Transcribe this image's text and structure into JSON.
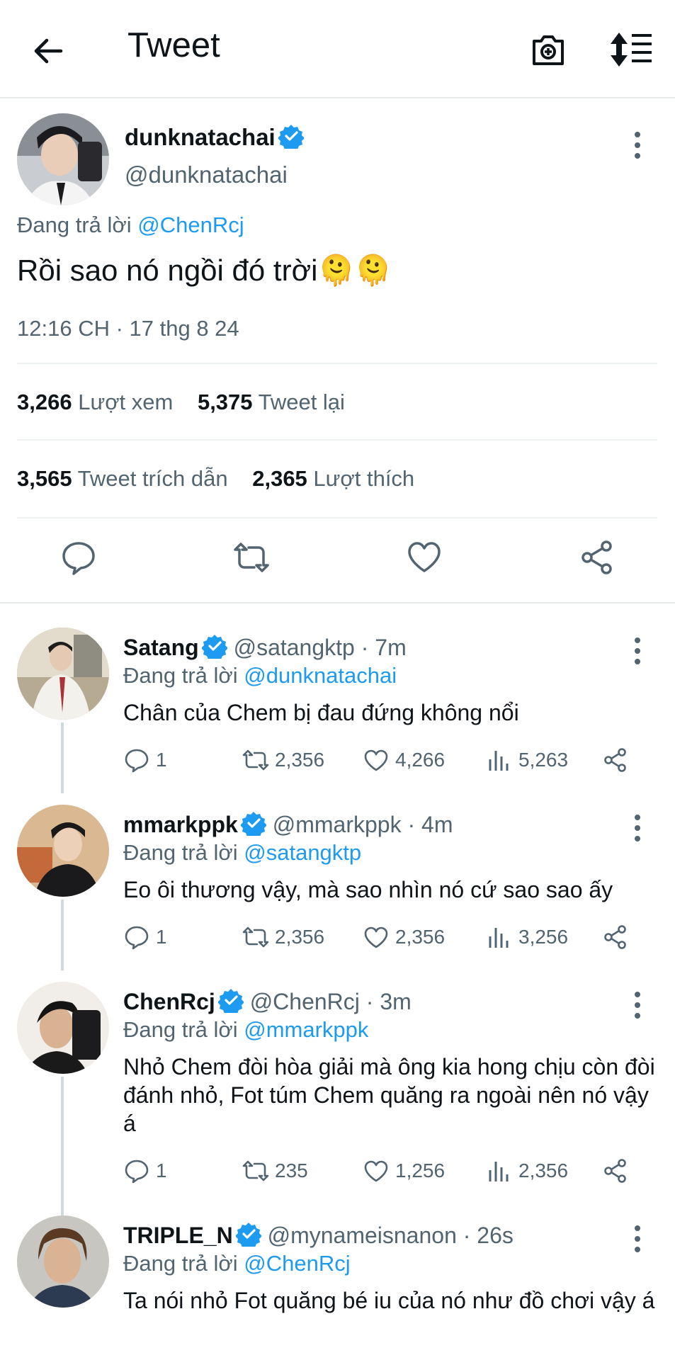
{
  "header": {
    "title": "Tweet"
  },
  "tweet": {
    "display_name": "dunknatachai",
    "handle": "@dunknatachai",
    "reply_prefix": "Đang trả lời",
    "reply_to": "@ChenRcj",
    "text": "Rồi sao nó ngồi đó trời🫠🫠",
    "timestamp": "12:16 CH · 17 thg 8 24",
    "stats": {
      "views_count": "3,266",
      "views_label": "Lượt xem",
      "retweets_count": "5,375",
      "retweets_label": "Tweet lại",
      "quotes_count": "3,565",
      "quotes_label": "Tweet trích dẫn",
      "likes_count": "2,365",
      "likes_label": "Lượt thích"
    }
  },
  "replies": [
    {
      "display_name": "Satang",
      "handle": "@satangktp",
      "time": "7m",
      "reply_prefix": "Đang trả lời",
      "reply_to": "@dunknatachai",
      "text": "Chân của Chem bị đau đứng không nổi",
      "comments": "1",
      "retweets": "2,356",
      "likes": "4,266",
      "views": "5,263"
    },
    {
      "display_name": "mmarkppk",
      "handle": "@mmarkppk",
      "time": "4m",
      "reply_prefix": "Đang trả lời",
      "reply_to": "@satangktp",
      "text": "Eo ôi thương vậy, mà sao nhìn nó cứ sao sao ấy",
      "comments": "1",
      "retweets": "2,356",
      "likes": "2,356",
      "views": "3,256"
    },
    {
      "display_name": "ChenRcj",
      "handle": "@ChenRcj",
      "time": "3m",
      "reply_prefix": "Đang trả lời",
      "reply_to": "@mmarkppk",
      "text": "Nhỏ Chem đòi hòa giải mà ông kia hong chịu còn đòi đánh nhỏ, Fot túm Chem quăng ra ngoài nên nó vậy á",
      "comments": "1",
      "retweets": "235",
      "likes": "1,256",
      "views": "2,356"
    },
    {
      "display_name": "TRIPLE_N",
      "handle": "@mynameisnanon",
      "time": "26s",
      "reply_prefix": "Đang trả lời",
      "reply_to": "@ChenRcj",
      "text": "Ta nói nhỏ Fot quăng bé iu của nó như đồ chơi vậy á"
    }
  ],
  "colors": {
    "accent": "#1d9bf0",
    "secondary_text": "#536471",
    "primary_text": "#0f1419"
  },
  "icons": [
    "back-arrow-icon",
    "camera-icon",
    "sort-icon",
    "verified-badge-icon",
    "more-vertical-icon",
    "reply-icon",
    "retweet-icon",
    "like-icon",
    "views-icon",
    "share-icon"
  ]
}
